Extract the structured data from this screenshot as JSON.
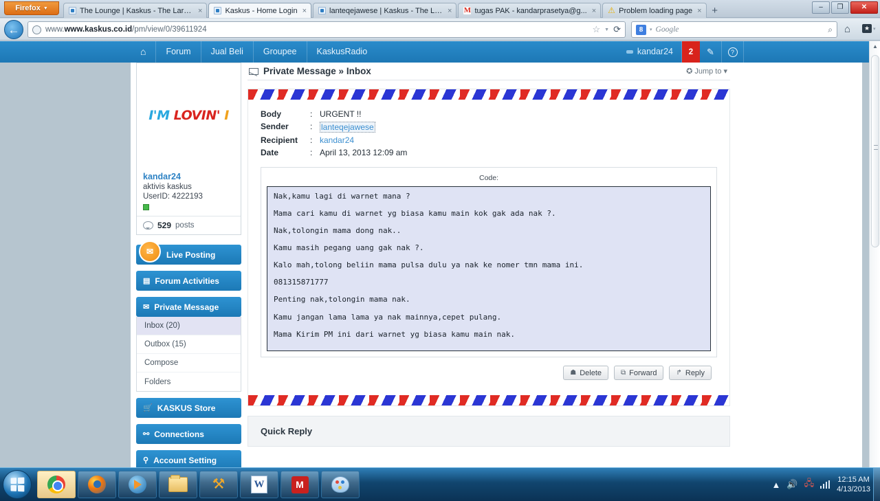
{
  "browser": {
    "firefox_button": "Firefox",
    "tabs": [
      {
        "title": "The Lounge | Kaskus - The Larg...",
        "icon": "kaskus-favicon",
        "active": false,
        "closable": true
      },
      {
        "title": "Kaskus - Home Login",
        "icon": "kaskus-favicon",
        "active": true,
        "closable": true
      },
      {
        "title": "lanteqejawese | Kaskus - The La...",
        "icon": "kaskus-favicon",
        "active": false,
        "closable": true
      },
      {
        "title": "tugas PAK - kandarprasetya@g...",
        "icon": "gmail-favicon",
        "active": false,
        "closable": true
      },
      {
        "title": "Problem loading page",
        "icon": "warning-favicon",
        "active": false,
        "closable": true
      }
    ],
    "new_tab_label": "+",
    "window_buttons": {
      "minimize": "–",
      "maximize": "❐",
      "close": "✕"
    },
    "url_prefix": "www.kaskus.co.id",
    "url_suffix": "/pm/view/0/39611924",
    "search_engine": "Google",
    "search_engine_letter": "8"
  },
  "kaskus_nav": {
    "home_icon": "home-icon",
    "items": [
      "Forum",
      "Jual Beli",
      "Groupee",
      "KaskusRadio"
    ],
    "username": "kandar24",
    "notification_count": "2",
    "pencil_icon": "✎",
    "help_icon": "?"
  },
  "sidebar": {
    "avatar_text": {
      "part1": "I'M",
      "part2": "LOVIN'",
      "part3": "I"
    },
    "username": "kandar24",
    "rank": "aktivis kaskus",
    "userid": "UserID: 4222193",
    "post_count": "529",
    "post_label": "posts",
    "buttons": [
      {
        "label": "Live Posting",
        "icon": "live-posting-icon"
      },
      {
        "label": "Forum Activities",
        "icon": "forum-activities-icon"
      },
      {
        "label": "Private Message",
        "icon": "envelope-icon"
      },
      {
        "label": "KASKUS Store",
        "icon": "cart-icon"
      },
      {
        "label": "Connections",
        "icon": "connections-icon"
      },
      {
        "label": "Account Setting",
        "icon": "key-icon"
      }
    ],
    "pm_submenu": [
      {
        "label": "Inbox (20)",
        "active": true
      },
      {
        "label": "Outbox (15)",
        "active": false
      },
      {
        "label": "Compose",
        "active": false
      },
      {
        "label": "Folders",
        "active": false
      }
    ]
  },
  "main": {
    "panel_title": "Private Message » Inbox",
    "jump_to": "Jump to",
    "fields": [
      {
        "key": "Body",
        "sep": ":",
        "value": "URGENT !!",
        "style": "plain"
      },
      {
        "key": "Sender",
        "sep": ":",
        "value": "lanteqejawese",
        "style": "focus-link"
      },
      {
        "key": "Recipient",
        "sep": ":",
        "value": "kandar24",
        "style": "link"
      },
      {
        "key": "Date",
        "sep": ":",
        "value": "April 13, 2013 12:09 am",
        "style": "plain"
      }
    ],
    "code_label": "Code:",
    "code_lines": [
      "Nak,kamu lagi di warnet mana ?",
      "Mama cari kamu di warnet yg biasa kamu main kok gak ada nak ?.",
      "Nak,tolongin mama dong nak..",
      "Kamu masih pegang uang gak nak ?.",
      "Kalo mah,tolong beliin mama pulsa dulu ya nak ke nomer tmn mama ini.",
      "081315871777",
      "Penting nak,tolongin mama nak.",
      "Kamu jangan lama lama ya nak mainnya,cepet pulang.",
      "Mama Kirim PM ini dari warnet yg biasa kamu main nak."
    ],
    "buttons": [
      {
        "label": "Delete",
        "icon": "trash-icon",
        "glyph": "☗"
      },
      {
        "label": "Forward",
        "icon": "forward-icon",
        "glyph": "⧉"
      },
      {
        "label": "Reply",
        "icon": "reply-icon",
        "glyph": "↱"
      }
    ],
    "quick_reply_title": "Quick Reply"
  },
  "taskbar": {
    "start_label": "start-orb",
    "apps": [
      {
        "name": "chrome",
        "active": true
      },
      {
        "name": "firefox",
        "active": false
      },
      {
        "name": "windows-media-player",
        "active": false
      },
      {
        "name": "windows-explorer",
        "active": false
      },
      {
        "name": "tools",
        "active": false
      },
      {
        "name": "microsoft-word",
        "active": false
      },
      {
        "name": "mcafee",
        "active": false
      },
      {
        "name": "paint",
        "active": false
      }
    ],
    "word_letter": "W",
    "mcafee_letter": "M",
    "time": "12:15 AM",
    "date": "4/13/2013"
  },
  "colors": {
    "kaskus_blue": "#1d78b5",
    "notification_red": "#d8231c",
    "link_blue": "#3c8fd0",
    "page_bg": "#b6c5cf",
    "airmail_red": "#e02b24",
    "airmail_blue": "#2b36d4"
  }
}
